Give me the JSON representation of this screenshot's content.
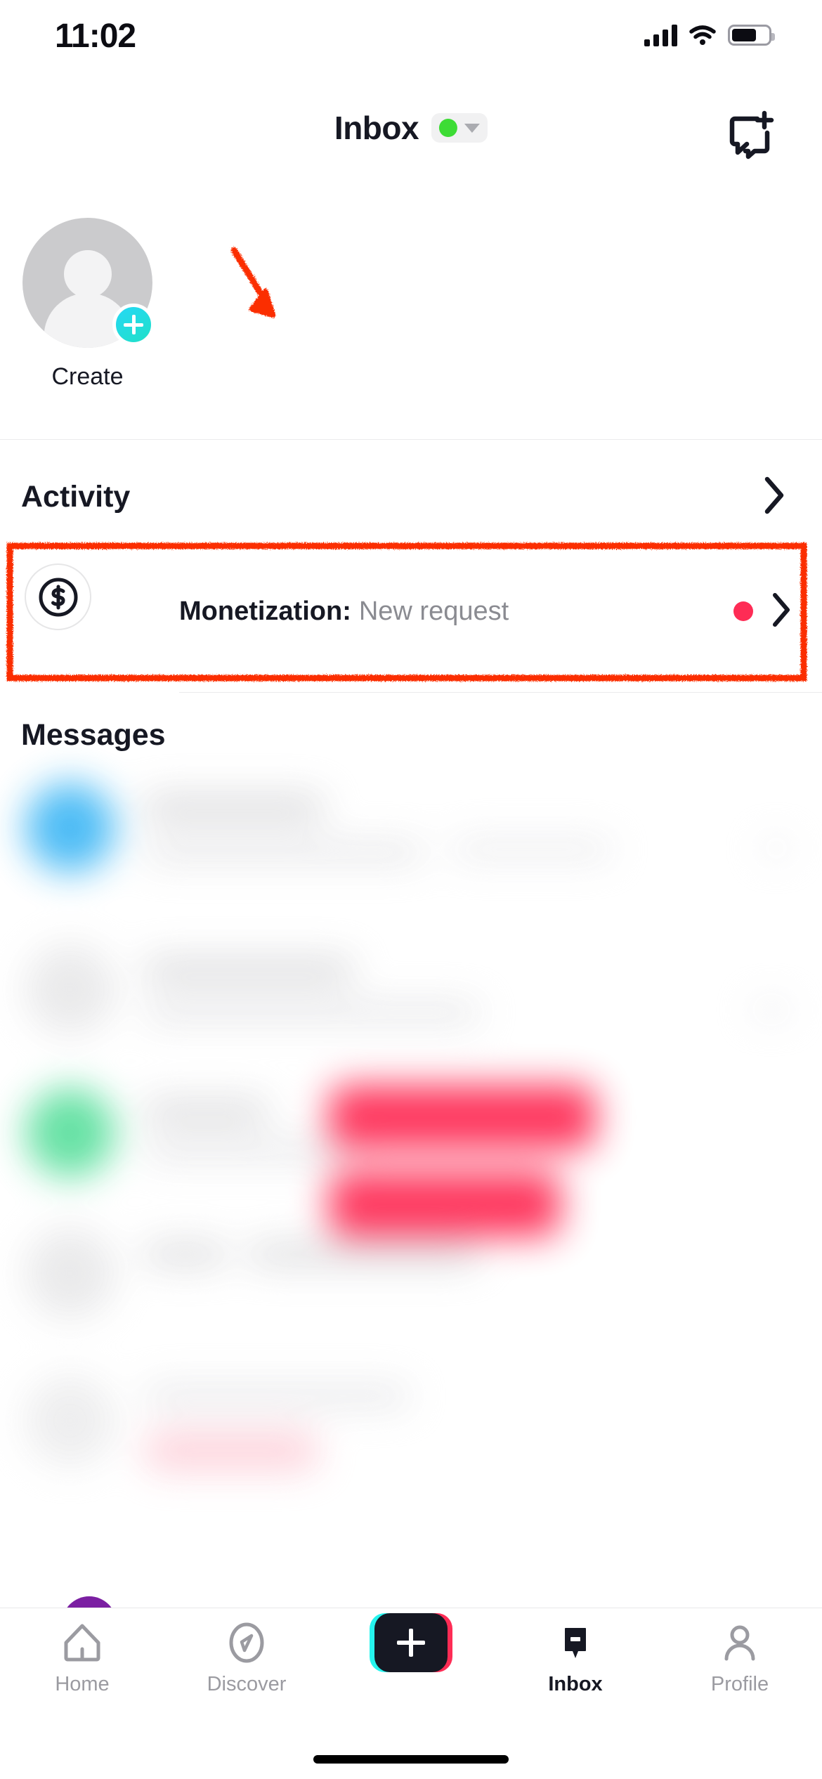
{
  "status_bar": {
    "time": "11:02",
    "signal_icon": "cellular-signal-icon",
    "wifi_icon": "wifi-icon",
    "battery_icon": "battery-icon"
  },
  "header": {
    "title": "Inbox",
    "status_pill": {
      "dot_color": "#3ddc35",
      "dot_icon": "online-status-dot",
      "caret_icon": "chevron-down-icon"
    },
    "new_message_icon": "new-message-icon"
  },
  "create_row": {
    "label": "Create",
    "avatar_icon": "default-avatar-icon",
    "plus_badge_icon": "plus-icon"
  },
  "activity": {
    "title": "Activity",
    "chevron_icon": "chevron-right-icon"
  },
  "monetization": {
    "icon": "dollar-circle-icon",
    "label": "Monetization:",
    "subtitle": "New request",
    "unread_dot_color": "#fe2c55",
    "chevron_icon": "chevron-right-icon"
  },
  "messages": {
    "heading": "Messages",
    "blurred_note": "message list is blurred for privacy",
    "rows": [
      {
        "avatar_color": "#45b9f5",
        "badge": null
      },
      {
        "avatar_color": "#e9e9ea",
        "badge": null
      },
      {
        "avatar_color": "#5fe0a0",
        "badge": "#fe2c55"
      },
      {
        "avatar_color": "#e9e9ea",
        "badge": "#fe2c55"
      },
      {
        "avatar_color": "#ededee",
        "badge": "#fdd3dc"
      }
    ]
  },
  "bottom_nav": {
    "items": [
      {
        "label": "Home",
        "icon": "home-icon",
        "active": false
      },
      {
        "label": "Discover",
        "icon": "compass-icon",
        "active": false
      },
      {
        "label": "",
        "icon": "create-plus-icon",
        "active": false
      },
      {
        "label": "Inbox",
        "icon": "inbox-icon",
        "active": true
      },
      {
        "label": "Profile",
        "icon": "person-icon",
        "active": false
      }
    ]
  },
  "annotations": {
    "highlight_color": "#fb2e00",
    "arrow_icon": "annotation-arrow-icon",
    "box_icon": "annotation-rectangle-icon",
    "target": "monetization"
  },
  "home_indicator": "home-indicator-bar"
}
